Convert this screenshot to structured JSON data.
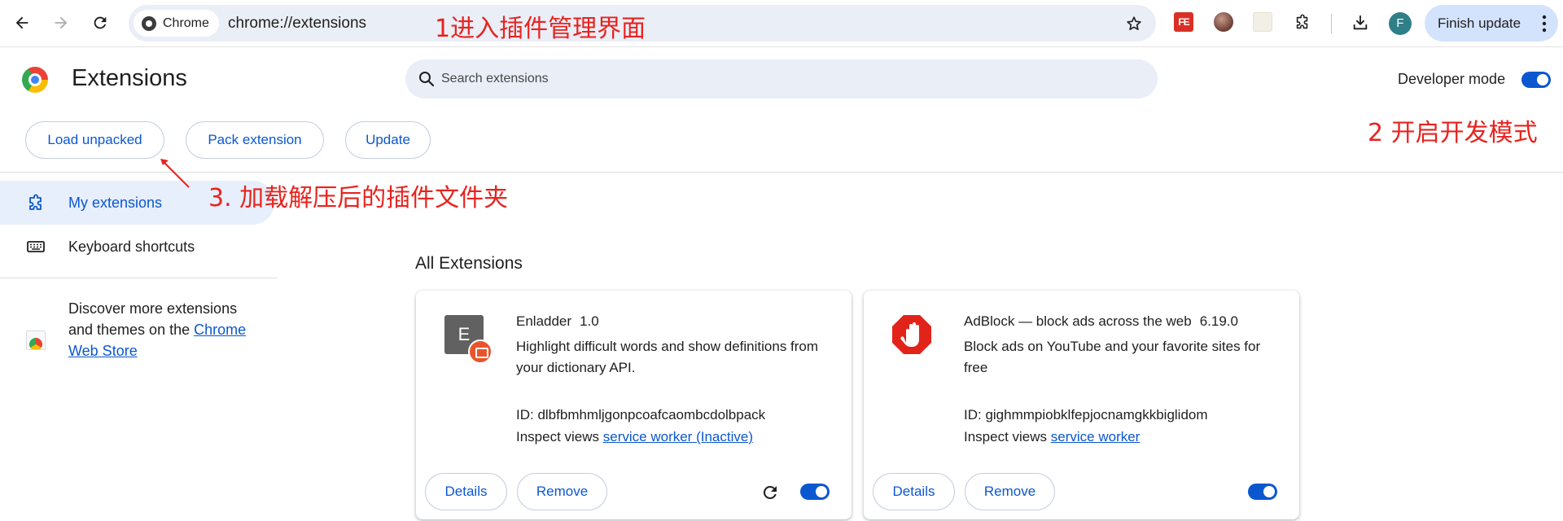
{
  "browser": {
    "chip_label": "Chrome",
    "url": "chrome://extensions",
    "ext_fe_label": "FE",
    "avatar_initial": "F",
    "finish_update_label": "Finish update"
  },
  "header": {
    "title": "Extensions",
    "search_placeholder": "Search extensions",
    "developer_mode_label": "Developer mode",
    "developer_mode_on": true
  },
  "actions": {
    "load_unpacked": "Load unpacked",
    "pack_extension": "Pack extension",
    "update": "Update"
  },
  "sidebar": {
    "items": [
      {
        "label": "My extensions",
        "icon": "extension-puzzle-icon",
        "active": true
      },
      {
        "label": "Keyboard shortcuts",
        "icon": "keyboard-icon",
        "active": false
      }
    ],
    "discover_text": "Discover more extensions and themes on the ",
    "discover_link": "Chrome Web Store"
  },
  "main": {
    "section_title": "All Extensions",
    "extensions": [
      {
        "name": "Enladder",
        "version": "1.0",
        "icon_letter": "E",
        "description": "Highlight difficult words and show definitions from your dictionary API.",
        "id_label": "ID: ",
        "id": "dlbfbmhmljgonpcoafcaombcdolbpack",
        "inspect_label": "Inspect views ",
        "inspect_link": "service worker (Inactive)",
        "details_label": "Details",
        "remove_label": "Remove",
        "enabled": true
      },
      {
        "name": "AdBlock — block ads across the web",
        "version": "6.19.0",
        "description": "Block ads on YouTube and your favorite sites for free",
        "id_label": "ID: ",
        "id": "gighmmpiobklfepjocnamgkkbiglidom",
        "inspect_label": "Inspect views ",
        "inspect_link": "service worker",
        "details_label": "Details",
        "remove_label": "Remove",
        "enabled": true
      }
    ]
  },
  "annotations": {
    "step1": "1进入插件管理界面",
    "step2": "2 开启开发模式",
    "step3": "3. 加载解压后的插件文件夹"
  },
  "colors": {
    "accent": "#0b57d0",
    "annotation": "#e8231f",
    "adblock_red": "#e2231a"
  }
}
